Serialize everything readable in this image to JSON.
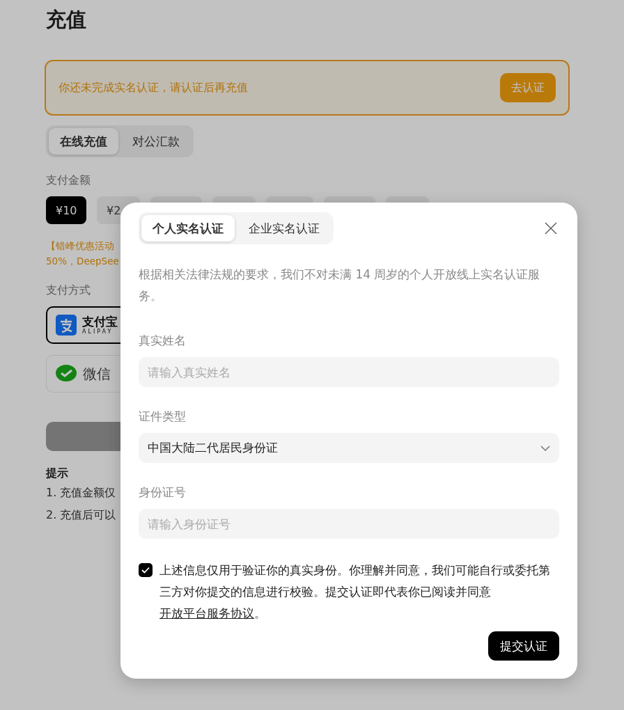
{
  "page": {
    "title": "充值"
  },
  "alert": {
    "message": "你还未完成实名认证，请认证后再充值",
    "button": "去认证"
  },
  "recharge_tabs": [
    {
      "label": "在线充值",
      "selected": true
    },
    {
      "label": "对公汇款",
      "selected": false
    }
  ],
  "amount_label": "支付金额",
  "amounts": [
    {
      "kind": "text",
      "label": "¥10",
      "selected": true
    },
    {
      "kind": "text",
      "label": "¥2",
      "selected": false
    },
    {
      "kind": "covered",
      "selected": false
    },
    {
      "kind": "covered",
      "selected": false
    },
    {
      "kind": "covered",
      "selected": false
    },
    {
      "kind": "covered",
      "selected": false
    },
    {
      "kind": "covered",
      "selected": false
    }
  ],
  "promo_lines": [
    "【错峰优惠活动",
    "50%，DeepSee"
  ],
  "payment_label": "支付方式",
  "payment_methods": [
    {
      "kind": "alipay",
      "label": "支付宝",
      "sublabel": "ALIPAY",
      "selected": true
    },
    {
      "kind": "wechat",
      "label": "微信",
      "selected": false
    }
  ],
  "tips": {
    "title": "提示",
    "items": [
      "1. 充值金额仅",
      "2. 充值后可以"
    ]
  },
  "dialog": {
    "tabs": [
      {
        "label": "个人实名认证",
        "selected": true
      },
      {
        "label": "企业实名认证",
        "selected": false
      }
    ],
    "description": "根据相关法律法规的要求，我们不对未满 14 周岁的个人开放线上实名认证服务。",
    "fields": [
      {
        "kind": "input",
        "label": "真实姓名",
        "placeholder": "请输入真实姓名"
      },
      {
        "kind": "select",
        "label": "证件类型",
        "value": "中国大陆二代居民身份证"
      },
      {
        "kind": "input",
        "label": "身份证号",
        "placeholder": "请输入身份证号"
      }
    ],
    "consent": {
      "checked": true,
      "text": "上述信息仅用于验证你的真实身份。你理解并同意，我们可能自行或委托第三方对你提交的信息进行校验。提交认证即代表你已阅读并同意",
      "link": "开放平台服务协议",
      "suffix": "。"
    },
    "submit": "提交认证"
  }
}
